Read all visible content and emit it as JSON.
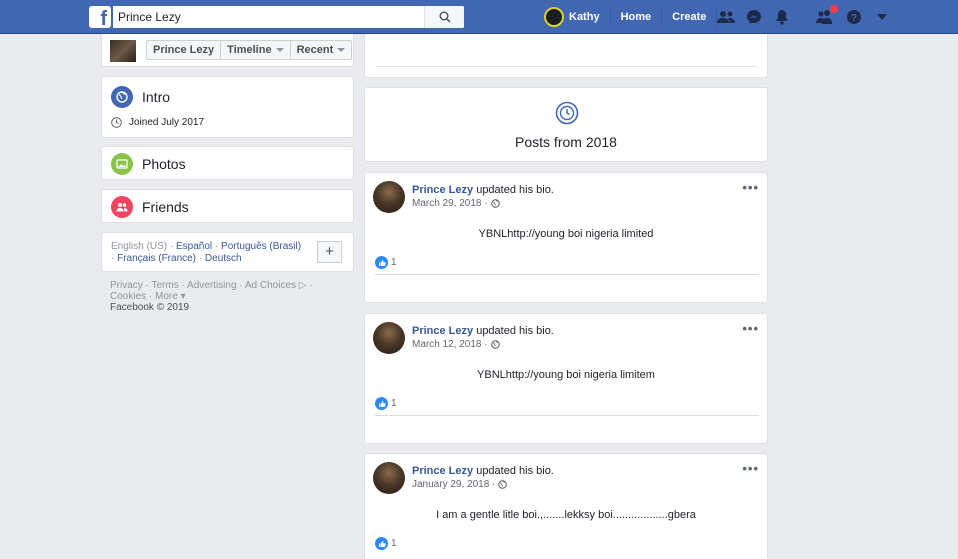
{
  "topbar": {
    "logo": "f",
    "search_value": "Prince Lezy",
    "user_name": "Kathy",
    "home_label": "Home",
    "create_label": "Create",
    "icons": [
      "friend-requests-icon",
      "messenger-icon",
      "notifications-icon",
      "groups-icon",
      "help-icon",
      "account-menu-icon"
    ]
  },
  "profile_header": {
    "name": "Prince Lezy",
    "timeline_label": "Timeline",
    "recent_label": "Recent"
  },
  "intro": {
    "title": "Intro",
    "joined": "Joined July 2017"
  },
  "photos": {
    "title": "Photos"
  },
  "friends": {
    "title": "Friends"
  },
  "languages": {
    "current": "English (US) · ",
    "lang1": "Español",
    "lang2": "Português (Brasil)",
    "lang3": "Français (France)",
    "lang4": "Deutsch",
    "add": "+"
  },
  "footer": {
    "line1": "Privacy · Terms · Advertising · Ad Choices ▷ ·",
    "line2": "Cookies · More ▾",
    "copyright": "Facebook © 2019"
  },
  "year_section": {
    "title": "Posts from 2018"
  },
  "posts": [
    {
      "author": "Prince Lezy",
      "action": " updated his bio.",
      "date": "March 29, 2018 · ",
      "body": "YBNLhttp://young boi nigeria limited",
      "likes": "1",
      "more": "•••"
    },
    {
      "author": "Prince Lezy",
      "action": " updated his bio.",
      "date": "March 12, 2018 · ",
      "body": "YBNLhttp://young boi nigeria limitem",
      "likes": "1",
      "more": "•••"
    },
    {
      "author": "Prince Lezy",
      "action": " updated his bio.",
      "date": "January 29, 2018 · ",
      "body": "I am a gentle litle boi.,.......lekksy boi..................gbera",
      "likes": "1",
      "more": "•••"
    }
  ],
  "colors": {
    "brand": "#4267b2",
    "link": "#365899",
    "intro_icon": "#4267b2",
    "photos_icon": "#8bc34a",
    "friends_icon": "#f3425f",
    "like": "#2d88ff"
  }
}
